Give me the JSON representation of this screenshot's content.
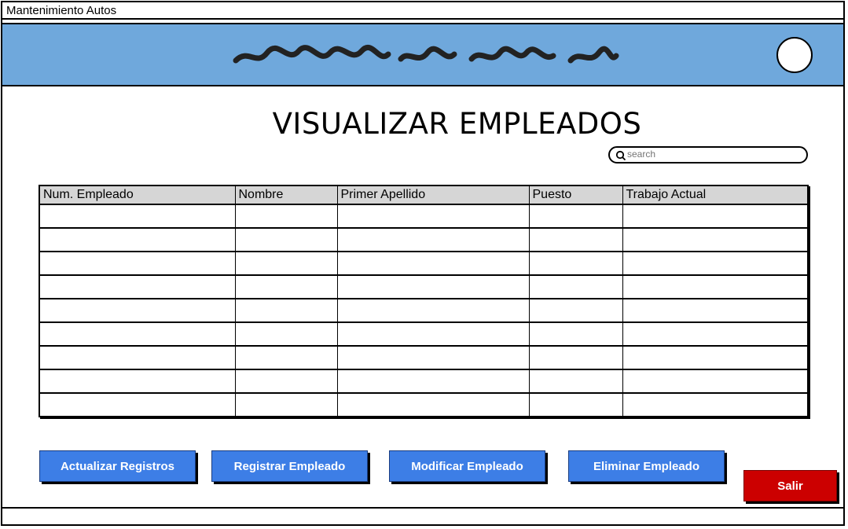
{
  "window": {
    "title": "Mantenimiento Autos"
  },
  "page": {
    "title": "VISUALIZAR EMPLEADOS"
  },
  "search": {
    "placeholder": "search"
  },
  "table": {
    "columns": [
      "Num. Empleado",
      "Nombre",
      "Primer Apellido",
      "Puesto",
      "Trabajo Actual"
    ],
    "rows": 9
  },
  "buttons": {
    "actualizar": "Actualizar Registros",
    "registrar": "Registrar Empleado",
    "modificar": "Modificar Empleado",
    "eliminar": "Eliminar Empleado",
    "salir": "Salir"
  },
  "colors": {
    "header_bg": "#6fa8dc",
    "primary_button": "#3d7ee6",
    "exit_button": "#cc0000",
    "table_header_bg": "#d6d6d6"
  }
}
